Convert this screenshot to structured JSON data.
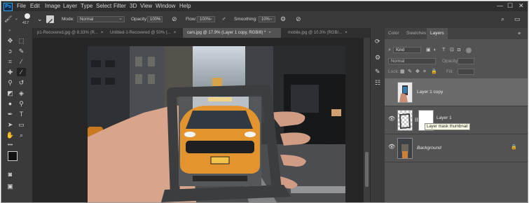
{
  "app": {
    "logo_text": "Ps"
  },
  "menu": [
    "File",
    "Edit",
    "Image",
    "Layer",
    "Type",
    "Select",
    "Filter",
    "3D",
    "View",
    "Window",
    "Help"
  ],
  "window_controls": {
    "minimize": "—",
    "maximize": "☐",
    "close": "✕"
  },
  "options": {
    "brush_size": "417",
    "mode_label": "Mode:",
    "mode_value": "Normal",
    "opacity_label": "Opacity:",
    "opacity_value": "100%",
    "flow_label": "Flow:",
    "flow_value": "100%",
    "smoothing_label": "Smoothing:",
    "smoothing_value": "10%"
  },
  "doc_tabs": [
    {
      "label": "p1-Recovered.jpg @ 8.33% (R...",
      "close": "×"
    },
    {
      "label": "Untitled-1-Recovered @ 50% (...",
      "close": "×"
    },
    {
      "label": "cars.jpg @ 17.9% (Layer 1 copy, RGB/8) *",
      "close": "×"
    },
    {
      "label": "mobile.jpg @ 10.3% (RGB/...",
      "close": "×"
    }
  ],
  "panel": {
    "tabs": [
      "Color",
      "Swatches",
      "Layers"
    ],
    "kind_filter": "Kind",
    "blend_mode": "Normal",
    "opacity_label": "Opacity:",
    "lock_label": "Lock:",
    "fill_label": "Fill:"
  },
  "layers": [
    {
      "name": "Layer 1 copy",
      "visible": false,
      "selected": true
    },
    {
      "name": "Layer 1",
      "visible": true,
      "selected": false
    },
    {
      "name": "Background",
      "visible": true,
      "selected": false,
      "locked": true
    }
  ],
  "tooltip": "Layer mask thumbnail",
  "colors": {
    "ui_dark": "#2e2e2e",
    "panel_bg": "#535353",
    "canvas_bg": "#262626",
    "accent_blue": "#31a8ff",
    "taxi_yellow": "#e3942e"
  }
}
